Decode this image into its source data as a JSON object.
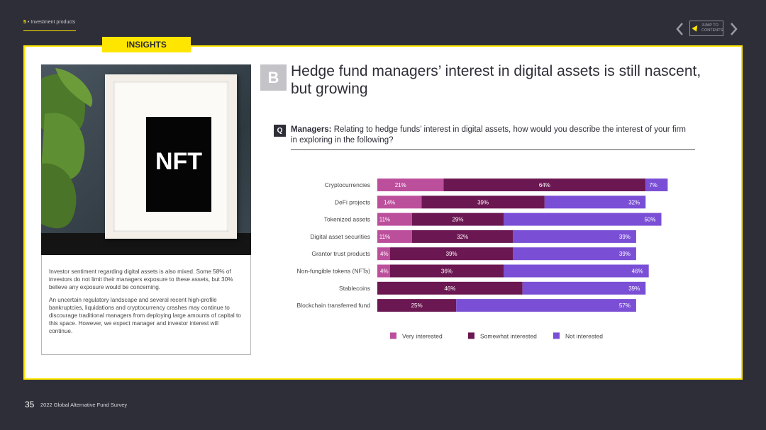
{
  "header": {
    "section_number": "5",
    "section_name": " • Investment products",
    "jump_line1": "JUMP TO",
    "jump_line2": "CONTENTS"
  },
  "colors": {
    "accent": "#ffe600",
    "background": "#2e2e38",
    "very_interested": "#bc4f9c",
    "somewhat_interested": "#6b1752",
    "not_interested": "#7a4fd6"
  },
  "insights_tab": "INSIGHTS",
  "photo": {
    "art_text": "NFT"
  },
  "body_text": {
    "p1": "Investor sentiment regarding digital assets is also mixed. Some 58% of investors do not limit their managers exposure to these assets, but 30% believe any exposure would be concerning.",
    "p2": "An uncertain regulatory landscape and several recent high-profile bankruptcies, liquidations and cryptocurrency crashes may continue to discourage traditional managers from deploying large amounts of capital to this space. However, we expect manager and investor interest will continue."
  },
  "section_badge": "B",
  "title": "Hedge fund managers’ interest in digital assets is still nascent, but growing",
  "question": {
    "badge": "Q",
    "lead": "Managers:",
    "text": " Relating to hedge funds’ interest in digital assets, how would you describe the interest of your firm in exploring in the following?"
  },
  "chart_data": {
    "type": "bar",
    "orientation": "horizontal-stacked",
    "unit": "%",
    "categories": [
      "Cryptocurrencies",
      "DeFi projects",
      "Tokenized assets",
      "Digital asset securities",
      "Grantor trust products",
      "Non-fungible tokens (NFTs)",
      "Stablecoins",
      "Blockchain transferred fund"
    ],
    "series": [
      {
        "name": "Very interested",
        "color": "#bc4f9c",
        "values": [
          21,
          14,
          11,
          11,
          4,
          4,
          0,
          0
        ]
      },
      {
        "name": "Somewhat interested",
        "color": "#6b1752",
        "values": [
          64,
          39,
          29,
          32,
          39,
          36,
          46,
          25
        ]
      },
      {
        "name": "Not interested",
        "color": "#7a4fd6",
        "values": [
          7,
          32,
          50,
          39,
          39,
          46,
          39,
          57
        ]
      }
    ],
    "legend_position": "bottom"
  },
  "footer": {
    "page_number": "35",
    "publication": "2022 Global Alternative Fund Survey"
  }
}
